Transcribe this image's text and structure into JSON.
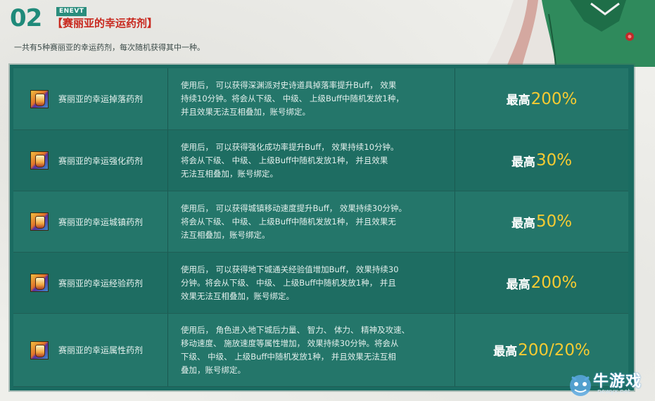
{
  "header": {
    "number": "02",
    "tag": "ENEVT",
    "title": "【赛丽亚的幸运药剂】",
    "subtitle": "一共有5种赛丽亚的幸运药剂，每次随机获得其中一种。"
  },
  "potions": [
    {
      "name": "赛丽亚的幸运掉落药剂",
      "icon": "potion-icon",
      "desc_lines": [
        "使用后， 可以获得深渊派对史诗道具掉落率提升Buff， 效果",
        "持续10分钟。将会从下级、 中级、 上级Buff中随机发放1种，",
        "并且效果无法互相叠加，账号绑定。"
      ],
      "value_prefix": "最高",
      "value": "200%"
    },
    {
      "name": "赛丽亚的幸运强化药剂",
      "icon": "potion-icon",
      "desc_lines": [
        "使用后， 可以获得强化成功率提升Buff， 效果持续10分钟。",
        "将会从下级、 中级、 上级Buff中随机发放1种， 并且效果",
        "无法互相叠加，账号绑定。"
      ],
      "value_prefix": "最高",
      "value": "30%"
    },
    {
      "name": "赛丽亚的幸运城镇药剂",
      "icon": "potion-icon",
      "desc_lines": [
        "使用后， 可以获得城镇移动速度提升Buff， 效果持续30分钟。",
        "将会从下级、 中级、 上级Buff中随机发放1种， 并且效果无",
        "法互相叠加，账号绑定。"
      ],
      "value_prefix": "最高",
      "value": "50%"
    },
    {
      "name": "赛丽亚的幸运经验药剂",
      "icon": "potion-icon",
      "desc_lines": [
        "使用后， 可以获得地下城通关经验值增加Buff， 效果持续30",
        "分钟。将会从下级、 中级、 上级Buff中随机发放1种， 并且",
        "效果无法互相叠加，账号绑定。"
      ],
      "value_prefix": "最高",
      "value": "200%"
    },
    {
      "name": "赛丽亚的幸运属性药剂",
      "icon": "potion-icon",
      "desc_lines": [
        "使用后， 角色进入地下城后力量、 智力、 体力、 精神及攻速、",
        "移动速度、 施放速度等属性增加， 效果持续30分钟。将会从",
        "下级、 中级、 上级Buff中随机发放1种， 并且效果无法互相",
        "叠加，账号绑定。"
      ],
      "value_prefix": "最高",
      "value": "200/20%"
    }
  ],
  "watermark": {
    "text": "牛游戏",
    "url": "newyx.net"
  },
  "colors": {
    "panel": "#1a6b61",
    "title_red": "#c8281e",
    "number_teal": "#1f8a7a",
    "value_gold": "#f6cb32"
  }
}
